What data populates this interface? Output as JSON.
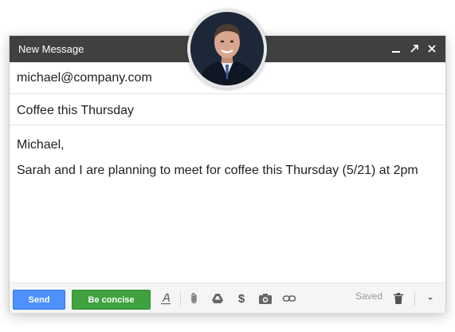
{
  "window": {
    "title": "New Message",
    "controls": [
      "minimize-icon",
      "expand-icon",
      "close-icon"
    ]
  },
  "compose": {
    "to": "michael@company.com",
    "subject": "Coffee this Thursday",
    "body": {
      "greeting": "Michael,",
      "text": "Sarah and I are planning to meet for coffee this Thursday (5/21) at 2pm"
    }
  },
  "toolbar": {
    "send_label": "Send",
    "concise_label": "Be concise",
    "saved_label": "Saved",
    "icons": [
      "formatting-icon",
      "attach-icon",
      "drive-icon",
      "money-icon",
      "camera-icon",
      "link-icon",
      "trash-icon",
      "more-options-icon"
    ]
  },
  "colors": {
    "titlebar": "#404040",
    "send_button": "#4d90fe",
    "concise_button": "#3fa23f"
  }
}
